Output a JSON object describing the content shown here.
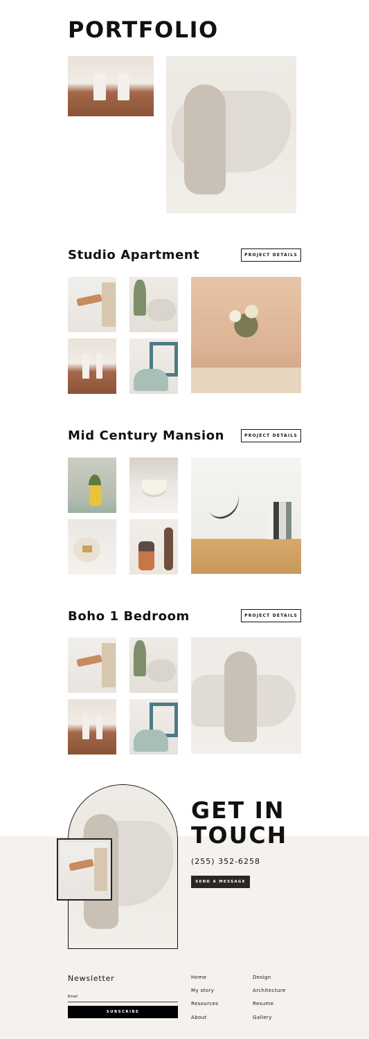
{
  "portfolio": {
    "title": "PORTFOLIO"
  },
  "projects": [
    {
      "title": "Studio Apartment",
      "button": "PROJECT DETAILS"
    },
    {
      "title": "Mid Century Mansion",
      "button": "PROJECT DETAILS"
    },
    {
      "title": "Boho 1 Bedroom",
      "button": "PROJECT DETAILS"
    }
  ],
  "contact": {
    "heading_line1": "GET IN",
    "heading_line2": "TOUCH",
    "phone": "(255) 352-6258",
    "button": "SEND A MESSAGE"
  },
  "newsletter": {
    "title": "Newsletter",
    "email_label": "Email",
    "email_value": "",
    "subscribe": "SUBSCRIBE"
  },
  "footer": {
    "col1": [
      "Home",
      "My story",
      "Resources",
      "About"
    ],
    "col2": [
      "Design",
      "Architecture",
      "Resume",
      "Gallery"
    ]
  },
  "colors": {
    "accent_dark": "#2c2624",
    "band_beige": "#f5f2ee"
  }
}
